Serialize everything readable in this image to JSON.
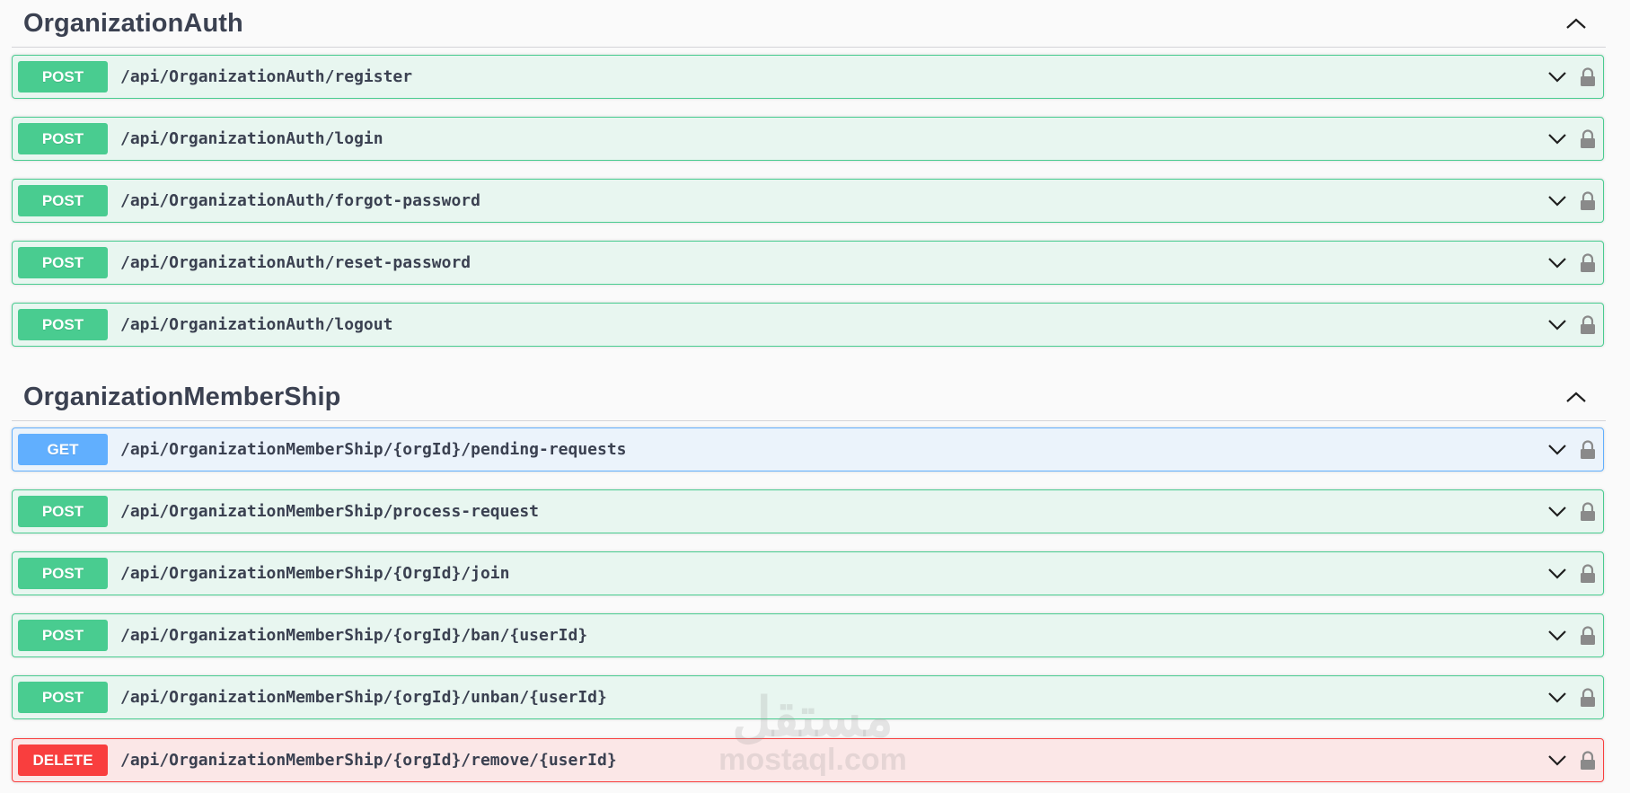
{
  "sections": [
    {
      "title": "OrganizationAuth",
      "operations": [
        {
          "method": "POST",
          "path": "/api/OrganizationAuth/register"
        },
        {
          "method": "POST",
          "path": "/api/OrganizationAuth/login"
        },
        {
          "method": "POST",
          "path": "/api/OrganizationAuth/forgot-password"
        },
        {
          "method": "POST",
          "path": "/api/OrganizationAuth/reset-password"
        },
        {
          "method": "POST",
          "path": "/api/OrganizationAuth/logout"
        }
      ]
    },
    {
      "title": "OrganizationMemberShip",
      "operations": [
        {
          "method": "GET",
          "path": "/api/OrganizationMemberShip/{orgId}/pending-requests"
        },
        {
          "method": "POST",
          "path": "/api/OrganizationMemberShip/process-request"
        },
        {
          "method": "POST",
          "path": "/api/OrganizationMemberShip/{OrgId}/join"
        },
        {
          "method": "POST",
          "path": "/api/OrganizationMemberShip/{orgId}/ban/{userId}"
        },
        {
          "method": "POST",
          "path": "/api/OrganizationMemberShip/{orgId}/unban/{userId}"
        },
        {
          "method": "DELETE",
          "path": "/api/OrganizationMemberShip/{orgId}/remove/{userId}"
        }
      ]
    }
  ],
  "watermark": {
    "arabic": "مستقل",
    "latin": "mostaql.com"
  },
  "colors": {
    "post": "#49cc90",
    "get": "#61affe",
    "delete": "#f93e3e",
    "text": "#3b4151"
  },
  "icons": {
    "section_toggle": "chevron-up-icon",
    "operation_expand": "chevron-down-icon",
    "operation_auth": "lock-icon"
  }
}
